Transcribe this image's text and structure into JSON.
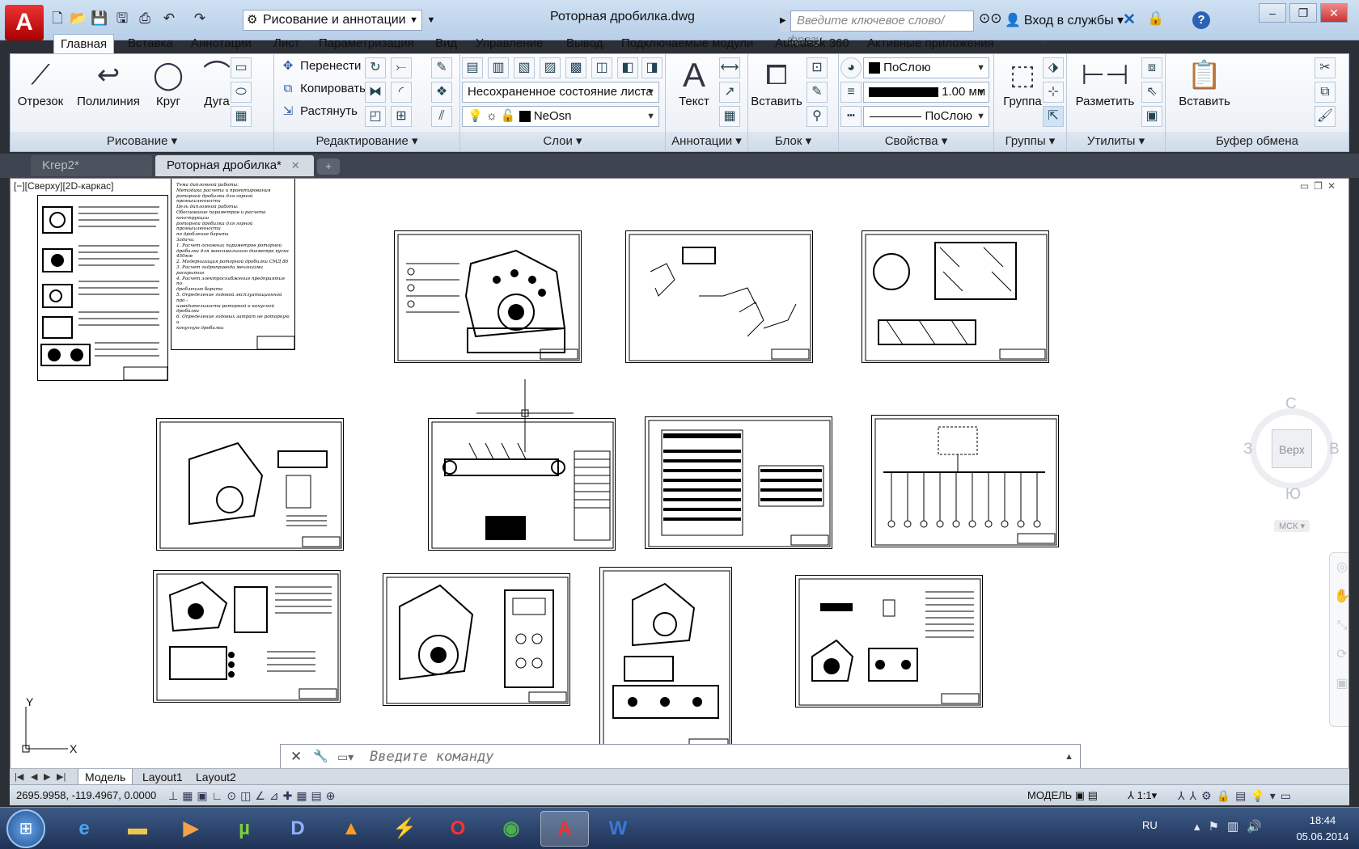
{
  "window": {
    "title": "Роторная дробилка.dwg",
    "workspace": "Рисование и аннотации",
    "search_placeholder": "Введите ключевое слово/фразу",
    "signin": "Вход в службы",
    "help": "?"
  },
  "ribbon_tabs": [
    "Главная",
    "Вставка",
    "Аннотации",
    "Лист",
    "Параметризация",
    "Вид",
    "Управление",
    "Вывод",
    "Подключаемые модули",
    "Autodesk 360",
    "Активные приложения"
  ],
  "panels": {
    "draw": {
      "title": "Рисование",
      "line": "Отрезок",
      "polyline": "Полилиния",
      "circle": "Круг",
      "arc": "Дуга"
    },
    "modify": {
      "title": "Редактирование",
      "move": "Перенести",
      "copy": "Копировать",
      "stretch": "Растянуть"
    },
    "layers": {
      "title": "Слои",
      "layer_state": "Несохраненное состояние листа",
      "current_layer": "NeOsn"
    },
    "annotation": {
      "title": "Аннотации",
      "text": "Текст"
    },
    "block": {
      "title": "Блок",
      "insert": "Вставить"
    },
    "properties": {
      "title": "Свойства",
      "color": "ПоСлою",
      "lineweight": "1.00 мм",
      "linetype": "ПоСлою"
    },
    "groups": {
      "title": "Группы",
      "group": "Группа"
    },
    "utilities": {
      "title": "Утилиты",
      "measure": "Разметить"
    },
    "clipboard": {
      "title": "Буфер обмена",
      "paste": "Вставить"
    }
  },
  "doc_tabs": [
    {
      "label": "Krep2*",
      "active": false
    },
    {
      "label": "Роторная дробилка*",
      "active": true
    }
  ],
  "viewport": {
    "label": "[−][Сверху][2D-каркас]",
    "viewcube": {
      "north": "С",
      "south": "Ю",
      "west": "З",
      "east": "В",
      "face": "Верх",
      "ucs": "МСК"
    },
    "ucs_y": "Y",
    "ucs_x": "X"
  },
  "sheet1_text": [
    "Тема дипломной работы:",
    "Методика расчета и проектирования",
    "роторной дробилки для горной промышленности",
    "Цель дипломной работы:",
    "Обоснование параметров и расчета конструкции",
    "роторной дробилки для горной промышленности",
    "по дробление барита",
    "Задачи:",
    "1. Расчет основных параметров роторной",
    "дробилки для максимального диаметра куска",
    "450мм",
    "2. Модернизация роторной дробилки СМД 86",
    "3. Расчет гидропривода механизма раскрытия",
    "4. Расчет электроснабжения предприятия по",
    "дроблению барита",
    "5. Определение годовой эксплуатационной про -",
    "изводительности роторной и конусной дробилки",
    "6. Определение годовых затрат не роторную и",
    "конусную дробилки"
  ],
  "command": {
    "placeholder": "Введите команду"
  },
  "layout_tabs": [
    "Модель",
    "Layout1",
    "Layout2"
  ],
  "status": {
    "coords": "2695.9958, -119.4967, 0.0000",
    "mode": "МОДЕЛЬ",
    "scale": "1:1"
  },
  "taskbar": {
    "lang": "RU",
    "time": "18:44",
    "date": "05.06.2014",
    "apps": [
      "ie",
      "explorer",
      "media",
      "utorrent",
      "daemon",
      "vlc",
      "tools",
      "opera",
      "chrome",
      "autocad",
      "word"
    ]
  }
}
